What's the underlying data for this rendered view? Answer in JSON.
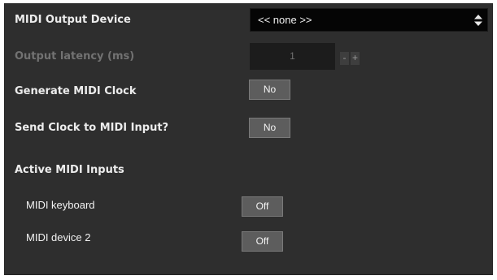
{
  "settings": {
    "midi_output_device": {
      "label": "MIDI Output Device",
      "value": "<< none >>",
      "icon": "up-down-arrows-icon"
    },
    "output_latency": {
      "label": "Output latency (ms)",
      "value": "1",
      "decrement": "-",
      "increment": "+",
      "enabled": false
    },
    "generate_midi_clock": {
      "label": "Generate MIDI Clock",
      "value": "No"
    },
    "send_clock_to_midi_input": {
      "label": "Send Clock to MIDI Input?",
      "value": "No"
    },
    "active_midi_inputs": {
      "label": "Active MIDI Inputs",
      "inputs": [
        {
          "name": "MIDI keyboard",
          "state": "Off"
        },
        {
          "name": "MIDI device 2",
          "state": "Off"
        }
      ]
    }
  },
  "colors": {
    "panel_background": "#2e2e2e",
    "button_background": "#5d5d5d",
    "select_background": "#050505",
    "disabled_text": "#727272"
  }
}
